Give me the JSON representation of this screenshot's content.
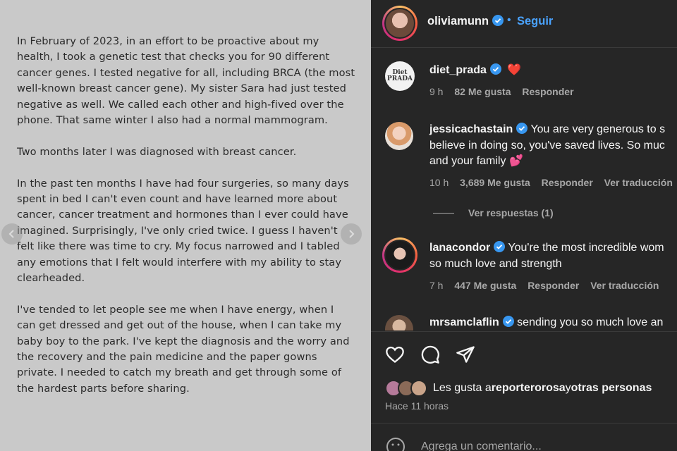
{
  "post": {
    "paragraphs": [
      "In February of 2023, in an effort to be proactive about my health, I took a genetic test that checks you for 90 different cancer genes.  I tested negative for all, including BRCA (the most well-known breast cancer gene).  My sister Sara had just tested negative as well.  We called each other and high-fived over the phone. That same winter I also had a normal mammogram.",
      "Two months later I was diagnosed with breast cancer.",
      "In the past ten months I have had four surgeries, so many days spent in bed I can't even count and have learned more about cancer, cancer treatment and hormones than I ever could have imagined.  Surprisingly, I've only cried twice.  I guess I haven't felt like there was time to cry.  My focus narrowed and I tabled any emotions that I felt would interfere with my ability to stay clearheaded.",
      "I've tended to let people see me when I have energy, when I can get dressed and get out of the house, when I can take my baby boy to the park.  I've kept the diagnosis and the worry and the recovery and the pain medicine and the paper gowns private.  I needed to catch my breath and get through some of the hardest parts before sharing."
    ]
  },
  "header": {
    "username": "oliviamunn",
    "dot": "•",
    "follow_label": "Seguir"
  },
  "comments": [
    {
      "username": "diet_prada",
      "avatar_text": "Diet PRADA",
      "text": "❤️",
      "time": "9 h",
      "likes": "82 Me gusta",
      "reply": "Responder",
      "translate": ""
    },
    {
      "username": "jessicachastain",
      "text_line1": "You are very generous to s",
      "text_line2": "believe in doing so, you've saved lives. So muc",
      "text_line3": "and your family 💕",
      "time": "10 h",
      "likes": "3,689 Me gusta",
      "reply": "Responder",
      "translate": "Ver traducción",
      "view_replies": "Ver respuestas (1)"
    },
    {
      "username": "lanacondor",
      "text_line1": "You're the most incredible wom",
      "text_line2": "so much love and strength",
      "time": "7 h",
      "likes": "447 Me gusta",
      "reply": "Responder",
      "translate": "Ver traducción"
    },
    {
      "username": "mrsamclaflin",
      "text_line1": "sending you so much love an"
    }
  ],
  "likes": {
    "prefix": "Les gusta a ",
    "user": "reporterorosa",
    "middle": " y ",
    "others": "otras personas"
  },
  "timeago": "Hace 11 horas",
  "add_comment": {
    "placeholder": "Agrega un comentario..."
  },
  "colors": {
    "accent": "#4aa3ff",
    "verified": "#3897f0",
    "panel_bg": "#262626",
    "muted": "#a8a8a8"
  }
}
